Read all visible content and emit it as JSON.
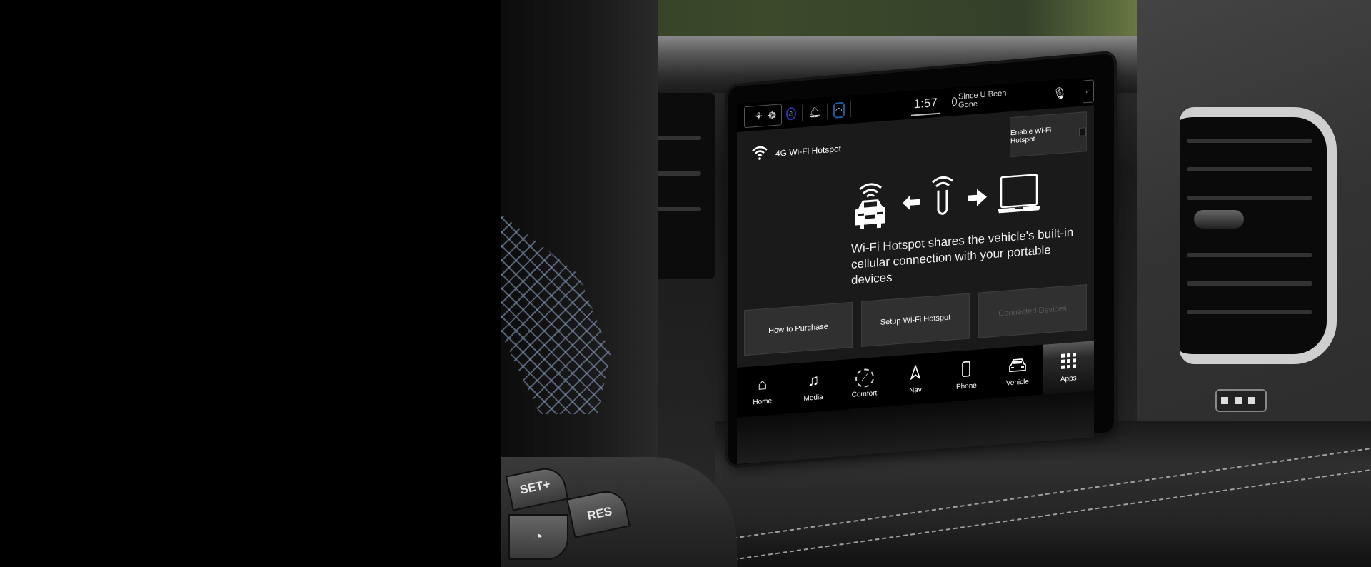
{
  "top_bar": {
    "icons": [
      "seat-heat-icon",
      "steering-heat-icon",
      "user-profile-icon",
      "notification-bell-icon",
      "wifi-icon",
      "microphone-icon",
      "seat-icon"
    ],
    "clock": "1:57",
    "now_playing": "Since U Been Gone"
  },
  "header": {
    "icon": "wifi-icon",
    "title": "4G Wi-Fi Hotspot",
    "enable_label": "Enable Wi-Fi Hotspot",
    "enable_checked": false
  },
  "diagram": {
    "items": [
      "car-wifi-icon",
      "arrow-left-icon",
      "hotspot-icon",
      "arrow-right-icon",
      "laptop-icon"
    ]
  },
  "description": "Wi-Fi Hotspot shares the vehicle's built-in cellular connection with your portable devices",
  "actions": [
    {
      "label": "How to Purchase",
      "enabled": true
    },
    {
      "label": "Setup Wi-Fi Hotspot",
      "enabled": true
    },
    {
      "label": "Connected Devices",
      "enabled": false
    }
  ],
  "nav": [
    {
      "label": "Home",
      "icon": "home-icon",
      "glyph": "⌂"
    },
    {
      "label": "Media",
      "icon": "music-note-icon",
      "glyph": "♫"
    },
    {
      "label": "Comfort",
      "icon": "comfort-seat-icon",
      "glyph": "♨"
    },
    {
      "label": "Nav",
      "icon": "navigation-arrow-icon",
      "glyph": "▲"
    },
    {
      "label": "Phone",
      "icon": "phone-icon",
      "glyph": "▯"
    },
    {
      "label": "Vehicle",
      "icon": "vehicle-icon",
      "glyph": "🚘"
    },
    {
      "label": "Apps",
      "icon": "apps-grid-icon",
      "active": true
    }
  ],
  "steering_wheel": {
    "buttons": [
      "SET+",
      "RES"
    ],
    "cruise_icon": "cruise-control-icon"
  },
  "colors": {
    "screen_bg": "#1a1a1a",
    "bar_bg": "#000000",
    "button_bg": "#303030",
    "profile_ring": "#2b2fb0",
    "wifi_ring": "#1f5a9a"
  }
}
